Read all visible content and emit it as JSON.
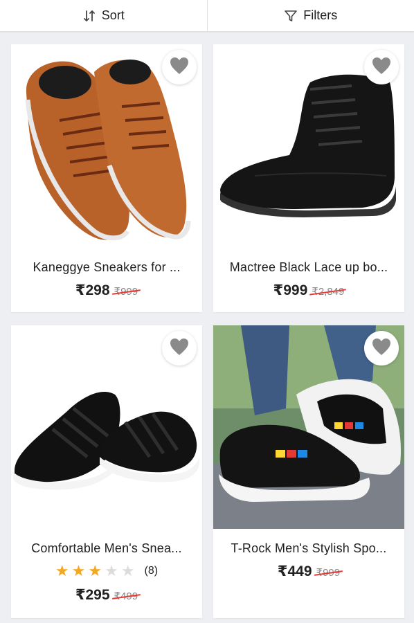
{
  "toolbar": {
    "sort_label": "Sort",
    "filters_label": "Filters",
    "sort_icon": "sort-icon",
    "filter_icon": "filter-icon"
  },
  "colors": {
    "background": "#eeeff3",
    "card": "#ffffff",
    "star_active": "#f5a623",
    "star_inactive": "#dcdcdc",
    "strike": "#e53935",
    "wishlist_heart": "#8a8a8a"
  },
  "products": [
    {
      "name": "Kaneggye Sneakers for ...",
      "price": "₹298",
      "mrp": "₹999",
      "image": "tan-leather-sneakers",
      "wishlist_icon": "heart-icon"
    },
    {
      "name": "Mactree Black Lace up bo...",
      "price": "₹999",
      "mrp": "₹2,849",
      "image": "black-leather-boots",
      "wishlist_icon": "heart-icon"
    },
    {
      "name": "Comfortable Men's Snea...",
      "price": "₹295",
      "mrp": "₹499",
      "rating": {
        "stars": 3,
        "out_of": 5,
        "count": "(8)"
      },
      "image": "black-slip-on-sneakers",
      "wishlist_icon": "heart-icon"
    },
    {
      "name": "T-Rock Men's Stylish Spo...",
      "price": "₹449",
      "mrp": "₹999",
      "image": "black-white-sports-shoes-worn",
      "wishlist_icon": "heart-icon"
    }
  ]
}
